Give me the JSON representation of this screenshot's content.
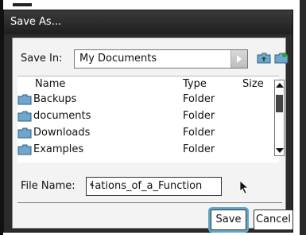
{
  "dialog": {
    "title": "Save As..."
  },
  "save_in": {
    "label": "Save In:",
    "value": "My Documents"
  },
  "list": {
    "headers": [
      "Name",
      "Type",
      "Size"
    ],
    "items": [
      {
        "name": "Backups",
        "type": "Folder"
      },
      {
        "name": "documents",
        "type": "Folder"
      },
      {
        "name": "Downloads",
        "type": "Folder"
      },
      {
        "name": "Examples",
        "type": "Folder"
      }
    ]
  },
  "file_name": {
    "label": "File Name:",
    "value": "ɬations_of_a_Function"
  },
  "buttons": {
    "save": "Save",
    "cancel": "Cancel"
  },
  "icons": {
    "up_folder": "folder-up-icon",
    "new_folder": "new-folder-icon",
    "folder": "folder-icon",
    "pointer": "mouse-pointer-icon"
  },
  "colors": {
    "title_bar": "#2b2b2b",
    "focus_ring": "#5fa7c9",
    "folder": "#6fa6cf"
  }
}
